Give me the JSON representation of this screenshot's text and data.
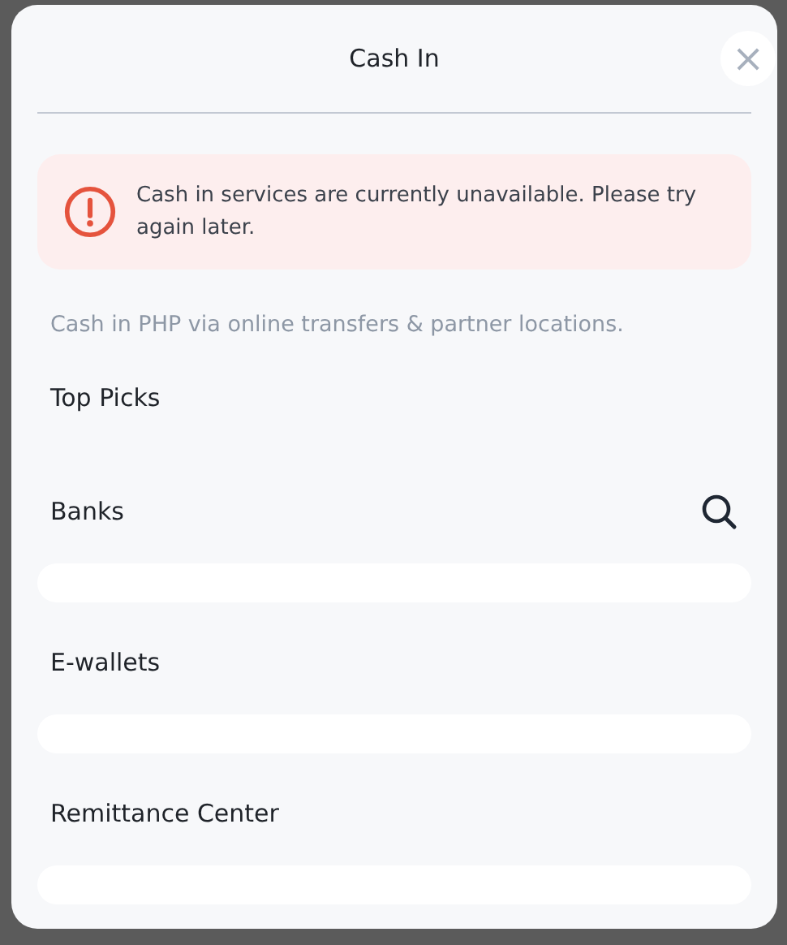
{
  "dialog": {
    "title": "Cash In",
    "close": "×"
  },
  "alert": {
    "message": "Cash in services are currently unavailable. Please try again later."
  },
  "description": "Cash in PHP via online transfers & partner locations.",
  "sections": [
    {
      "title": "Top Picks",
      "kind": "plain",
      "searchable": false
    },
    {
      "title": "Banks",
      "kind": "list",
      "searchable": true
    },
    {
      "title": "E-wallets",
      "kind": "list",
      "searchable": false
    },
    {
      "title": "Remittance Center",
      "kind": "list",
      "searchable": false
    }
  ]
}
